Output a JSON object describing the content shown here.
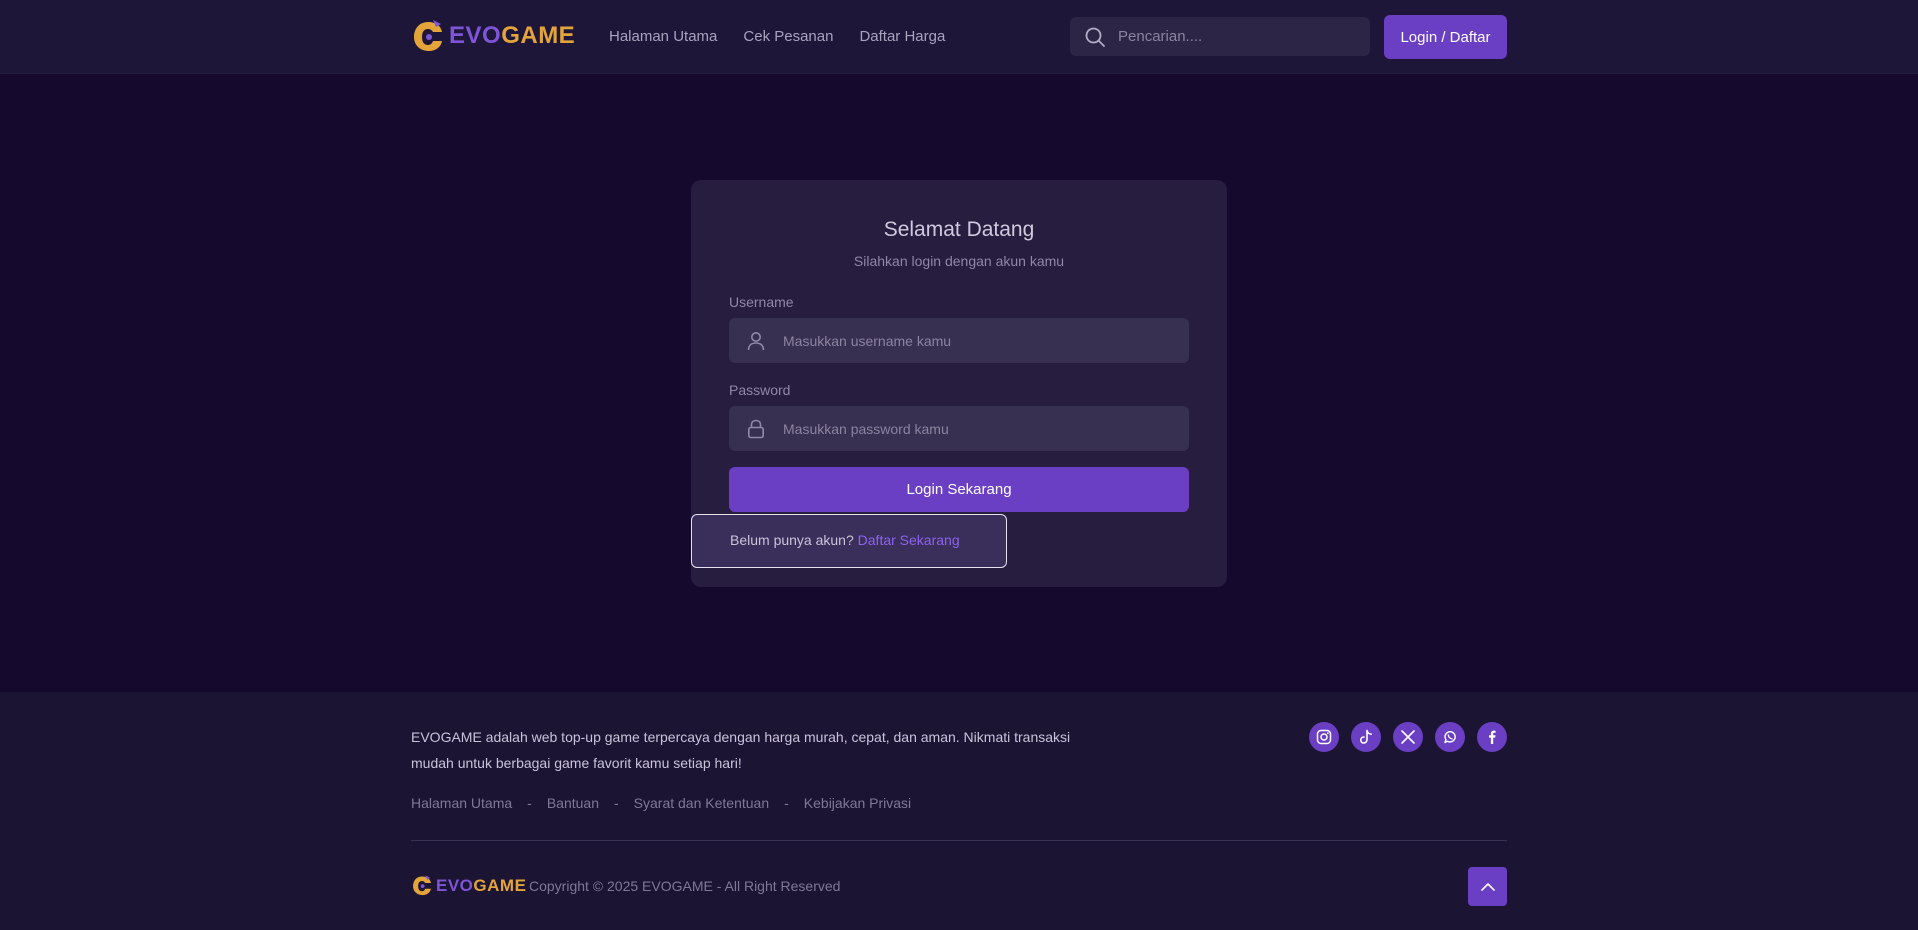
{
  "brand": {
    "part1": "EVO",
    "part2": "GAME"
  },
  "nav": [
    {
      "label": "Halaman Utama"
    },
    {
      "label": "Cek Pesanan"
    },
    {
      "label": "Daftar Harga"
    }
  ],
  "search": {
    "placeholder": "Pencarian...."
  },
  "header_button": "Login / Daftar",
  "login": {
    "title": "Selamat Datang",
    "subtitle": "Silahkan login dengan akun kamu",
    "username_label": "Username",
    "username_placeholder": "Masukkan username kamu",
    "password_label": "Password",
    "password_placeholder": "Masukkan password kamu",
    "submit": "Login Sekarang",
    "register_prompt": "Belum punya akun?",
    "register_link": "Daftar Sekarang"
  },
  "footer": {
    "description": "EVOGAME adalah web top-up game terpercaya dengan harga murah, cepat, dan aman. Nikmati transaksi mudah untuk berbagai game favorit kamu setiap hari!",
    "links": [
      "Halaman Utama",
      "Bantuan",
      "Syarat dan Ketentuan",
      "Kebijakan Privasi"
    ],
    "separator": "-",
    "socials": [
      "instagram-icon",
      "tiktok-icon",
      "x-icon",
      "whatsapp-icon",
      "facebook-icon"
    ],
    "copyright": "Copyright © 2025 EVOGAME - All Right Reserved"
  },
  "colors": {
    "background": "#150a2e",
    "accent": "#6b3fc4",
    "brand_purple": "#7d55d6",
    "brand_gold": "#e3a53a",
    "link": "#8e62f0"
  }
}
